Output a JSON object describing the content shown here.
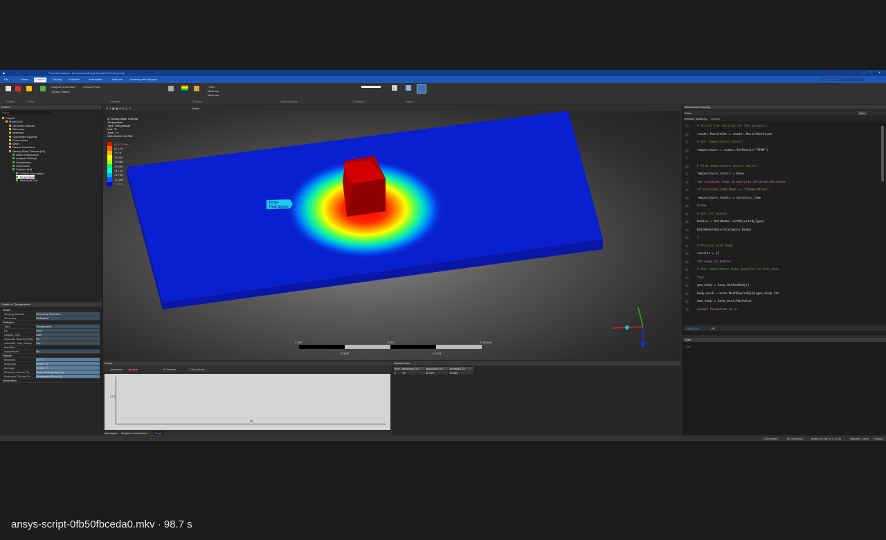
{
  "window": {
    "title": "Thermal Analysis - Mechanical [Ansys Mechanical Enterprise]"
  },
  "menu": {
    "tabs": [
      "File",
      "Home",
      "Context",
      "Display",
      "Selection",
      "Automation",
      "Add-ons",
      "Learning and Support"
    ],
    "active_index": 2,
    "search_placeholder": "Quick Launch"
  },
  "ribbon": {
    "groups": [
      "Outline",
      "Solve",
      "Results",
      "Display",
      "Vector Display",
      "Graphics",
      "Views"
    ],
    "results_labels": [
      "Capped IsoSurface",
      "Section Planes",
      "Contour Plots"
    ],
    "display_labels": [
      "Probe",
      "Maximum",
      "Minimum"
    ]
  },
  "outline": {
    "title": "Outline",
    "filter_label": "Name",
    "items": [
      {
        "label": "Project*",
        "depth": 0
      },
      {
        "label": "Model (A4)",
        "depth": 1
      },
      {
        "label": "Geometry Imports",
        "depth": 2
      },
      {
        "label": "Geometry",
        "depth": 2
      },
      {
        "label": "Materials",
        "depth": 2
      },
      {
        "label": "Coordinate Systems",
        "depth": 2
      },
      {
        "label": "Connections",
        "depth": 2
      },
      {
        "label": "Mesh",
        "depth": 2
      },
      {
        "label": "Named Selections",
        "depth": 2
      },
      {
        "label": "Steady-State Thermal (A5)",
        "depth": 2
      },
      {
        "label": "Initial Temperature",
        "depth": 3
      },
      {
        "label": "Analysis Settings",
        "depth": 3
      },
      {
        "label": "Temperature",
        "depth": 3
      },
      {
        "label": "Convection",
        "depth": 3
      },
      {
        "label": "Solution (A6)",
        "depth": 3
      },
      {
        "label": "Solution Information",
        "depth": 4
      },
      {
        "label": "Temperature",
        "depth": 4,
        "selected": true
      },
      {
        "label": "Total Heat Flux",
        "depth": 4
      }
    ]
  },
  "details": {
    "title": "Details of \"Temperature\"",
    "sections": [
      {
        "name": "Scope",
        "rows": [
          [
            "Scoping Method",
            "Geometry Selection"
          ],
          [
            "Geometry",
            "All Bodies"
          ]
        ]
      },
      {
        "name": "Definition",
        "rows": [
          [
            "Type",
            "Temperature"
          ],
          [
            "By",
            "Time"
          ],
          [
            "Display Time",
            "Last"
          ],
          [
            "Separate Data by Entity",
            "No"
          ],
          [
            "Calculate Time History",
            "Yes"
          ],
          [
            "Identifier",
            ""
          ],
          [
            "Suppressed",
            "No"
          ]
        ]
      },
      {
        "name": "Results",
        "rows": [
          [
            "Minimum",
            "70. °C"
          ],
          [
            "Maximum",
            "82.575 °C"
          ],
          [
            "Average",
            "75.662 °C"
          ],
          [
            "Minimum Occurs On",
            "Layer Heating Spot (1)"
          ],
          [
            "Maximum Occurs On",
            "Component Block (1)"
          ]
        ]
      },
      {
        "name": "Information",
        "rows": []
      }
    ]
  },
  "viewport": {
    "toolbar_label": "Select",
    "legend": {
      "header": [
        "A: Steady-State Thermal",
        "Temperature",
        "Type: Temperature",
        "Unit: °C",
        "Time: 1 s",
        "10/12/2024 4:35 PM"
      ],
      "values": [
        "82.575 Max",
        "81.178",
        "79.78",
        "78.383",
        "76.986",
        "75.589",
        "74.192",
        "72.795",
        "71.398",
        "70 Min"
      ],
      "colors": [
        "#ff0000",
        "#ff6a00",
        "#ffb400",
        "#ffff00",
        "#b4ff00",
        "#00ff66",
        "#00ffd2",
        "#00b4ff",
        "#005aff",
        "#0000ff"
      ]
    },
    "probe_label": [
      "Probe",
      "Heat Source"
    ],
    "scale_labels": [
      "0.000",
      "0.015",
      "0.030 (m)",
      "0.0075",
      "0.0225"
    ],
    "accent_colors": {
      "plate": "#0a1fd0",
      "block": "#c80000",
      "hot": "#ff0000"
    }
  },
  "graph": {
    "title": "Graph",
    "label": "Animation",
    "frames": "20 Frames",
    "duration": "2 Sec (Auto)",
    "x_label": "[s]",
    "y_label": "[°C]",
    "tabs": [
      "Messages",
      "Graphics Annotations",
      "Graph"
    ]
  },
  "tabular": {
    "title": "Tabular Data",
    "headers": [
      "Time [s]",
      "Minimum [°C]",
      "Maximum [°C]",
      "Average [°C]"
    ],
    "rows": [
      [
        "1.",
        "70.",
        "82.575",
        "75.662"
      ]
    ]
  },
  "scripting": {
    "title": "Mechanical Scripting",
    "editor_label": "Editor",
    "run_label": "Run",
    "file_tab": "thermal_results.py",
    "tab2": "Journal",
    "lines": [
      {
        "n": "23",
        "t": "# Access the solution of the analysis",
        "c": "#6a9955"
      },
      {
        "n": "24",
        "t": "reader.ResultSet = reader.ResultSetCount",
        "c": "#d4d4d4"
      },
      {
        "n": "25",
        "t": "# Get temperature result",
        "c": "#6a9955"
      },
      {
        "n": "26",
        "t": "temperature = reader.GetResult(\"TEMP\")",
        "c": "#d4d4d4"
      },
      {
        "n": "27",
        "t": "",
        "c": "#d4d4d4"
      },
      {
        "n": "30",
        "t": "# Find temperature result object",
        "c": "#6a9955"
      },
      {
        "n": "32",
        "t": "temperature_result = None",
        "c": "#d4d4d4"
      },
      {
        "n": "34",
        "t": "for solution_item in analysis.Solution.Children:",
        "c": "#c586c0"
      },
      {
        "n": "36",
        "t": "    if solution_item.Name == \"Temperature\":",
        "c": "#ce9178"
      },
      {
        "n": "38",
        "t": "        temperature_result = solution_item",
        "c": "#d4d4d4"
      },
      {
        "n": "40",
        "t": "        break",
        "c": "#c586c0"
      },
      {
        "n": "44",
        "t": "# Get all bodies",
        "c": "#6a9955"
      },
      {
        "n": "48",
        "t": "bodies = DataModel.GetObjectsByType(",
        "c": "#d4d4d4"
      },
      {
        "n": "49",
        "t": "    DataModelObjectCategory.Body)",
        "c": "#d4d4d4"
      },
      {
        "n": "50",
        "t": ")",
        "c": "#d4d4d4"
      },
      {
        "n": "54",
        "t": "# Process each body",
        "c": "#6a9955"
      },
      {
        "n": "58",
        "t": "results = []",
        "c": "#d4d4d4"
      },
      {
        "n": "60",
        "t": "for body in bodies:",
        "c": "#c586c0"
      },
      {
        "n": "62",
        "t": "    # Get temperature data specific to this body",
        "c": "#6a9955"
      },
      {
        "n": "63",
        "t": "    try:",
        "c": "#c586c0"
      },
      {
        "n": "64",
        "t": "        geo_body = body.GetGeoBody()",
        "c": "#d4d4d4"
      },
      {
        "n": "66",
        "t": "        body_mesh = mesh.MeshRegionById(geo_body.Id)",
        "c": "#d4d4d4"
      },
      {
        "n": "68",
        "t": "        max_temp = body_mesh.MaxValue",
        "c": "#d4d4d4"
      },
      {
        "n": "70",
        "t": "    except Exception as e:",
        "c": "#c586c0"
      }
    ]
  },
  "shell": {
    "title": "Shell",
    "prompt": ">>>"
  },
  "status": {
    "messages": "1 Messages",
    "selection": "No Selection",
    "units": "Metric (m, kg, N, s, V, A)",
    "degrees": "Degrees",
    "rad": "rad/s",
    "celsius": "Celsius"
  },
  "caption": "ansys-script-0fb50fbceda0.mkv · 98.7 s"
}
